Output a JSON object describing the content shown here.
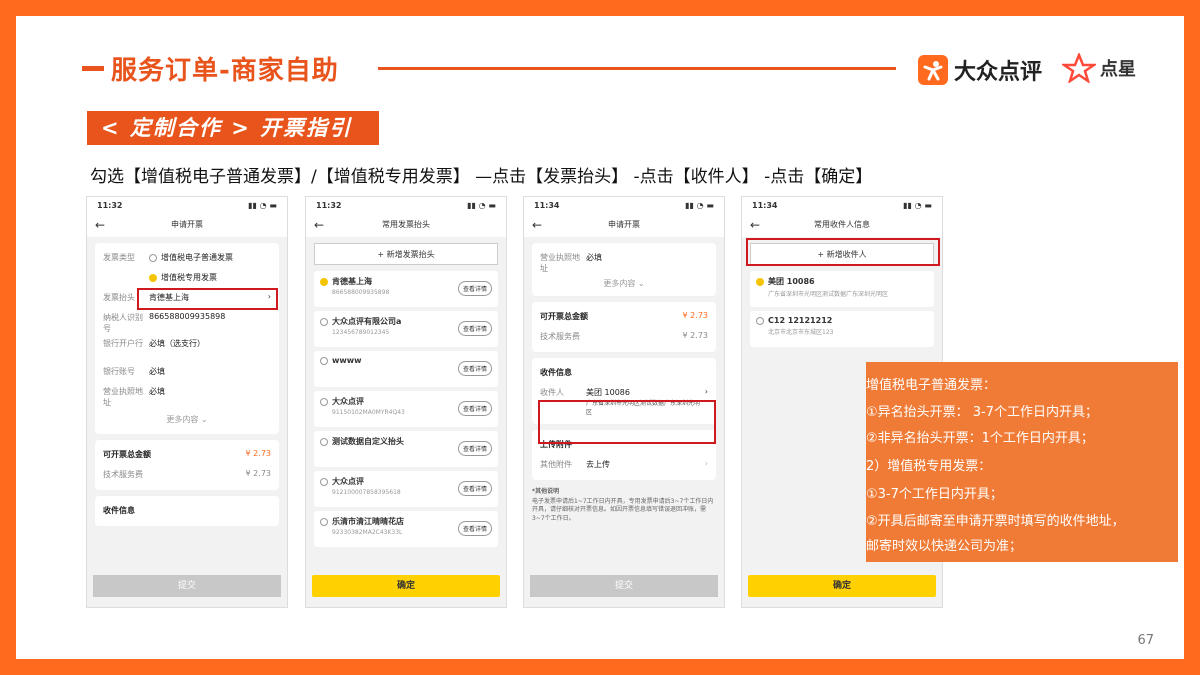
{
  "header": {
    "title": "服务订单-商家自助",
    "logo_dianping": "大众点评",
    "logo_dianxing": "点星"
  },
  "banner": "< 定制合作 > 开票指引",
  "instruction": "勾选【增值税电子普通发票】/【增值税专用发票】 —点击【发票抬头】 -点击【收件人】 -点击【确定】",
  "phone1": {
    "time": "11:32",
    "title": "申请开票",
    "type_label": "发票类型",
    "type_opt1": "增值税电子普通发票",
    "type_opt2": "增值税专用发票",
    "head_label": "发票抬头",
    "head_value": "肯德基上海",
    "tax_label": "纳税人识别号",
    "tax_value": "866588009935898",
    "bank_label": "银行开户行",
    "bank_value": "必填（选支行）",
    "acct_label": "银行账号",
    "acct_value": "必填",
    "addr_label": "营业执照地址",
    "addr_value": "必填",
    "more": "更多内容",
    "total_label": "可开票总金额",
    "total_value": "¥ 2.73",
    "fee_label": "技术服务费",
    "fee_value": "¥ 2.73",
    "recv_label": "收件信息",
    "submit": "提交"
  },
  "phone2": {
    "time": "11:32",
    "title": "常用发票抬头",
    "add": "+ 新增发票抬头",
    "detail": "查看详情",
    "items": [
      {
        "name": "肯德基上海",
        "sub": "866588009935898"
      },
      {
        "name": "大众点评有限公司a",
        "sub": "123456789012345"
      },
      {
        "name": "wwww",
        "sub": ""
      },
      {
        "name": "大众点评",
        "sub": "91150102MA0MYR4Q43"
      },
      {
        "name": "测试数据自定义抬头",
        "sub": ""
      },
      {
        "name": "大众点评",
        "sub": "912100007858395618"
      },
      {
        "name": "乐清市清江晴晴花店",
        "sub": "92330382MA2C43K33L"
      }
    ],
    "confirm": "确定"
  },
  "phone3": {
    "time": "11:34",
    "title": "申请开票",
    "addr_label": "营业执照地址",
    "addr_value": "必填",
    "more": "更多内容",
    "total_label": "可开票总金额",
    "total_value": "¥ 2.73",
    "fee_label": "技术服务费",
    "fee_value": "¥ 2.73",
    "recv_section": "收件信息",
    "recv_label": "收件人",
    "recv_name": "美团 10086",
    "recv_addr": "广东省深圳市光明区测试数据广东深圳光明区",
    "attach_section": "上传附件",
    "attach_label": "其他附件",
    "attach_value": "去上传",
    "note_title": "*其他说明",
    "note_text": "电子发票申请后1~7工作日内开具，专用发票申请后3~7个工作日内开具，请仔细核对开票信息。如因开票信息填写错误退回冲账，需3~7个工作日。",
    "submit": "提交"
  },
  "phone4": {
    "time": "11:34",
    "title": "常用收件人信息",
    "add": "+ 新增收件人",
    "items": [
      {
        "name": "美团   10086",
        "sub": "广东省深圳市光明区测试数据广东深圳光明区"
      },
      {
        "name": "C12   12121212",
        "sub": "北京市北京市东城区123"
      }
    ],
    "confirm": "确定"
  },
  "notes": [
    "增值税电子普通发票：",
    "①异名抬头开票： 3-7个工作日内开具；",
    "②非异名抬头开票：1个工作日内开具；",
    "2）增值税专用发票：",
    "①3-7个工作日内开具；",
    "②开具后邮寄至申请开票时填写的收件地址，",
    "邮寄时效以快递公司为准；"
  ],
  "page_number": "67",
  "colors": {
    "brand_orange": "#e8541c",
    "highlight_red": "#d0181f",
    "button_yellow": "#ffd100"
  }
}
